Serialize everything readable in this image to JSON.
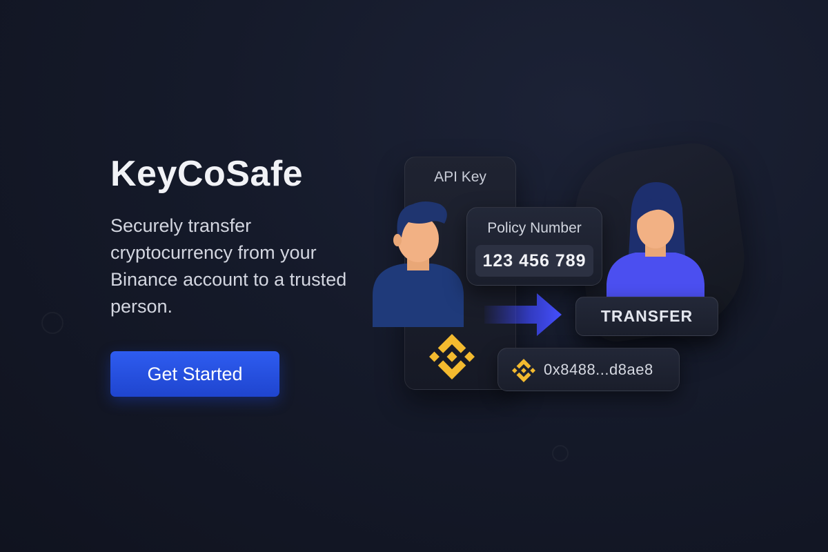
{
  "hero": {
    "title": "KeyCoSafe",
    "subtitle": "Securely transfer cryptocurrency from your Binance account to a trusted person.",
    "cta_label": "Get Started"
  },
  "illustration": {
    "api_key_label": "API Key",
    "policy_label": "Policy Number",
    "policy_number": "123 456 789",
    "transfer_label": "TRANSFER",
    "wallet_address": "0x8488...d8ae8",
    "icons": [
      "sender-avatar-icon",
      "recipient-avatar-icon",
      "binance-logo-icon",
      "transfer-arrow-icon"
    ]
  },
  "colors": {
    "background": "#151a2a",
    "accent": "#2e5cf0",
    "binance_yellow": "#f3ba2f",
    "recipient_shirt": "#4b4ff0",
    "sender_shirt": "#1f3a7a"
  }
}
